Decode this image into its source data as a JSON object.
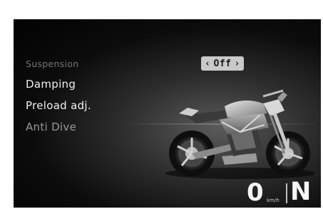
{
  "menu": {
    "header": "Suspension",
    "items": [
      {
        "label": "Damping"
      },
      {
        "label": "Preload adj."
      },
      {
        "label": "Anti Dive"
      }
    ]
  },
  "value": {
    "left_arrow": "‹",
    "text": "Off",
    "right_arrow": "›"
  },
  "status": {
    "speed": "0",
    "speed_unit": "km/h",
    "gear": "N"
  },
  "colors": {
    "screen_bg": "#050505",
    "value_box": "#c9c9c9",
    "text_active": "#f2f2f2",
    "text_header": "#747474"
  },
  "icons": [
    "motorcycle-illustration"
  ]
}
